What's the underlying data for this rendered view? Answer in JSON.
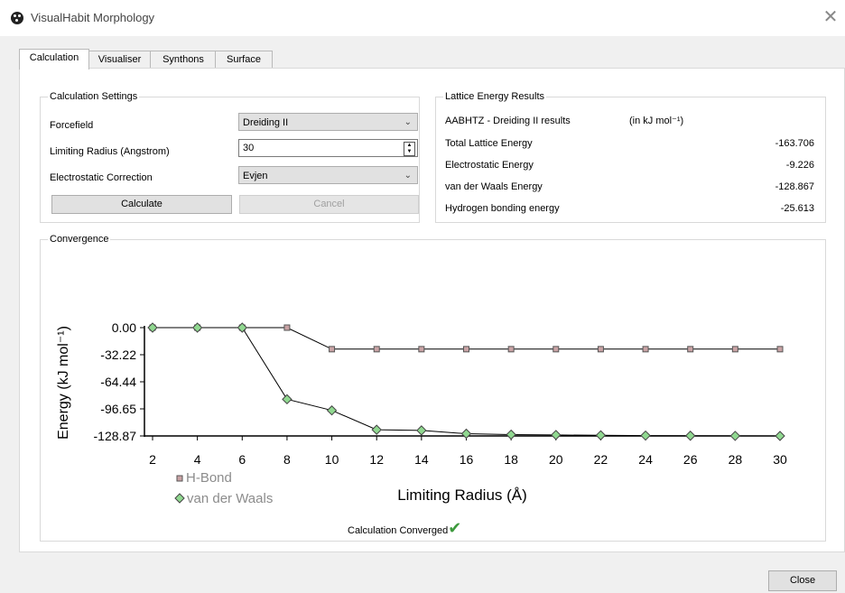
{
  "window": {
    "title": "VisualHabit Morphology",
    "close_glyph": "✕",
    "icon": "habit-logo-icon"
  },
  "tabs": [
    {
      "label": "Calculation",
      "active": true
    },
    {
      "label": "Visualiser",
      "active": false
    },
    {
      "label": "Synthons",
      "active": false
    },
    {
      "label": "Surface",
      "active": false
    }
  ],
  "settings": {
    "title": "Calculation Settings",
    "forcefield_label": "Forcefield",
    "forcefield_value": "Dreiding II",
    "radius_label": "Limiting Radius (Angstrom)",
    "radius_value": "30",
    "electrostatic_label": "Electrostatic Correction",
    "electrostatic_value": "Evjen",
    "calculate_label": "Calculate",
    "cancel_label": "Cancel"
  },
  "results": {
    "title": "Lattice Energy Results",
    "header": "AABHTZ - Dreiding II results",
    "units": "(in kJ mol⁻¹)",
    "rows": [
      {
        "label": "Total Lattice Energy",
        "value": "-163.706"
      },
      {
        "label": "Electrostatic Energy",
        "value": "-9.226"
      },
      {
        "label": "van der Waals Energy",
        "value": "-128.867"
      },
      {
        "label": "Hydrogen bonding energy",
        "value": "-25.613"
      }
    ]
  },
  "convergence": {
    "title": "Convergence",
    "status": "Calculation Converged",
    "status_icon": "checkmark-icon"
  },
  "chart_data": {
    "type": "line",
    "xlabel": "Limiting Radius (Å)",
    "ylabel": "Energy (kJ mol⁻¹)",
    "x": [
      2,
      4,
      6,
      8,
      10,
      12,
      14,
      16,
      18,
      20,
      22,
      24,
      26,
      28,
      30
    ],
    "xticks": [
      "2",
      "4",
      "6",
      "8",
      "10",
      "12",
      "14",
      "16",
      "18",
      "20",
      "22",
      "24",
      "26",
      "28",
      "30"
    ],
    "yticks": [
      "0.00",
      "-32.22",
      "-64.44",
      "-96.65",
      "-128.87"
    ],
    "ytick_values": [
      0,
      -32.22,
      -64.44,
      -96.65,
      -128.87
    ],
    "ylim": [
      -128.87,
      0
    ],
    "xlim": [
      2,
      30
    ],
    "grid": false,
    "legend_position": "bottom-left",
    "series": [
      {
        "name": "H-Bond",
        "marker": "square",
        "color": "#c9a3a5",
        "values": [
          0,
          0,
          0,
          0,
          -25.61,
          -25.61,
          -25.61,
          -25.61,
          -25.61,
          -25.61,
          -25.61,
          -25.61,
          -25.61,
          -25.61,
          -25.61
        ]
      },
      {
        "name": "van der Waals",
        "marker": "diamond",
        "color": "#90d890",
        "values": [
          0,
          0,
          0,
          -85.2,
          -98.5,
          -121.5,
          -122.3,
          -126.2,
          -127.3,
          -127.7,
          -128.1,
          -128.4,
          -128.6,
          -128.8,
          -128.87
        ]
      }
    ]
  },
  "footer": {
    "close_label": "Close"
  }
}
